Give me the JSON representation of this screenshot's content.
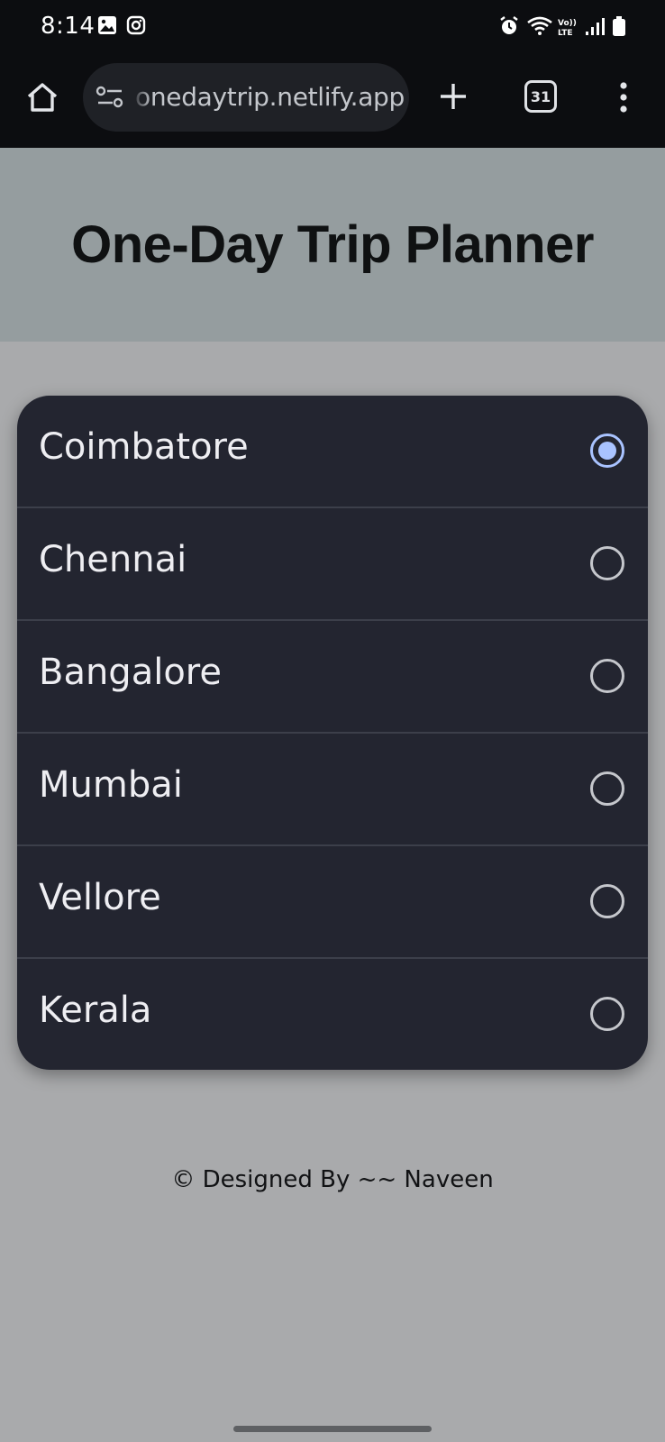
{
  "status_bar": {
    "time": "8:14",
    "left_icons": [
      "gallery-notification-icon",
      "instagram-notification-icon"
    ],
    "right_icons": [
      "alarm-icon",
      "wifi-icon",
      "volte-icon",
      "signal-icon",
      "battery-icon"
    ]
  },
  "browser": {
    "url": "onedaytrip.netlify.app",
    "tab_count": "31"
  },
  "page": {
    "title": "One-Day Trip Planner",
    "cities": [
      {
        "label": "Coimbatore",
        "checked": true
      },
      {
        "label": "Chennai",
        "checked": false
      },
      {
        "label": "Bangalore",
        "checked": false
      },
      {
        "label": "Mumbai",
        "checked": false
      },
      {
        "label": "Vellore",
        "checked": false
      },
      {
        "label": "Kerala",
        "checked": false
      }
    ],
    "footer": "© Designed By ~~ Naveen"
  },
  "colors": {
    "radio_selected": "#a9c3ff",
    "list_background": "#232530",
    "header_background": "#959d9f",
    "page_background": "#a9aaac"
  }
}
